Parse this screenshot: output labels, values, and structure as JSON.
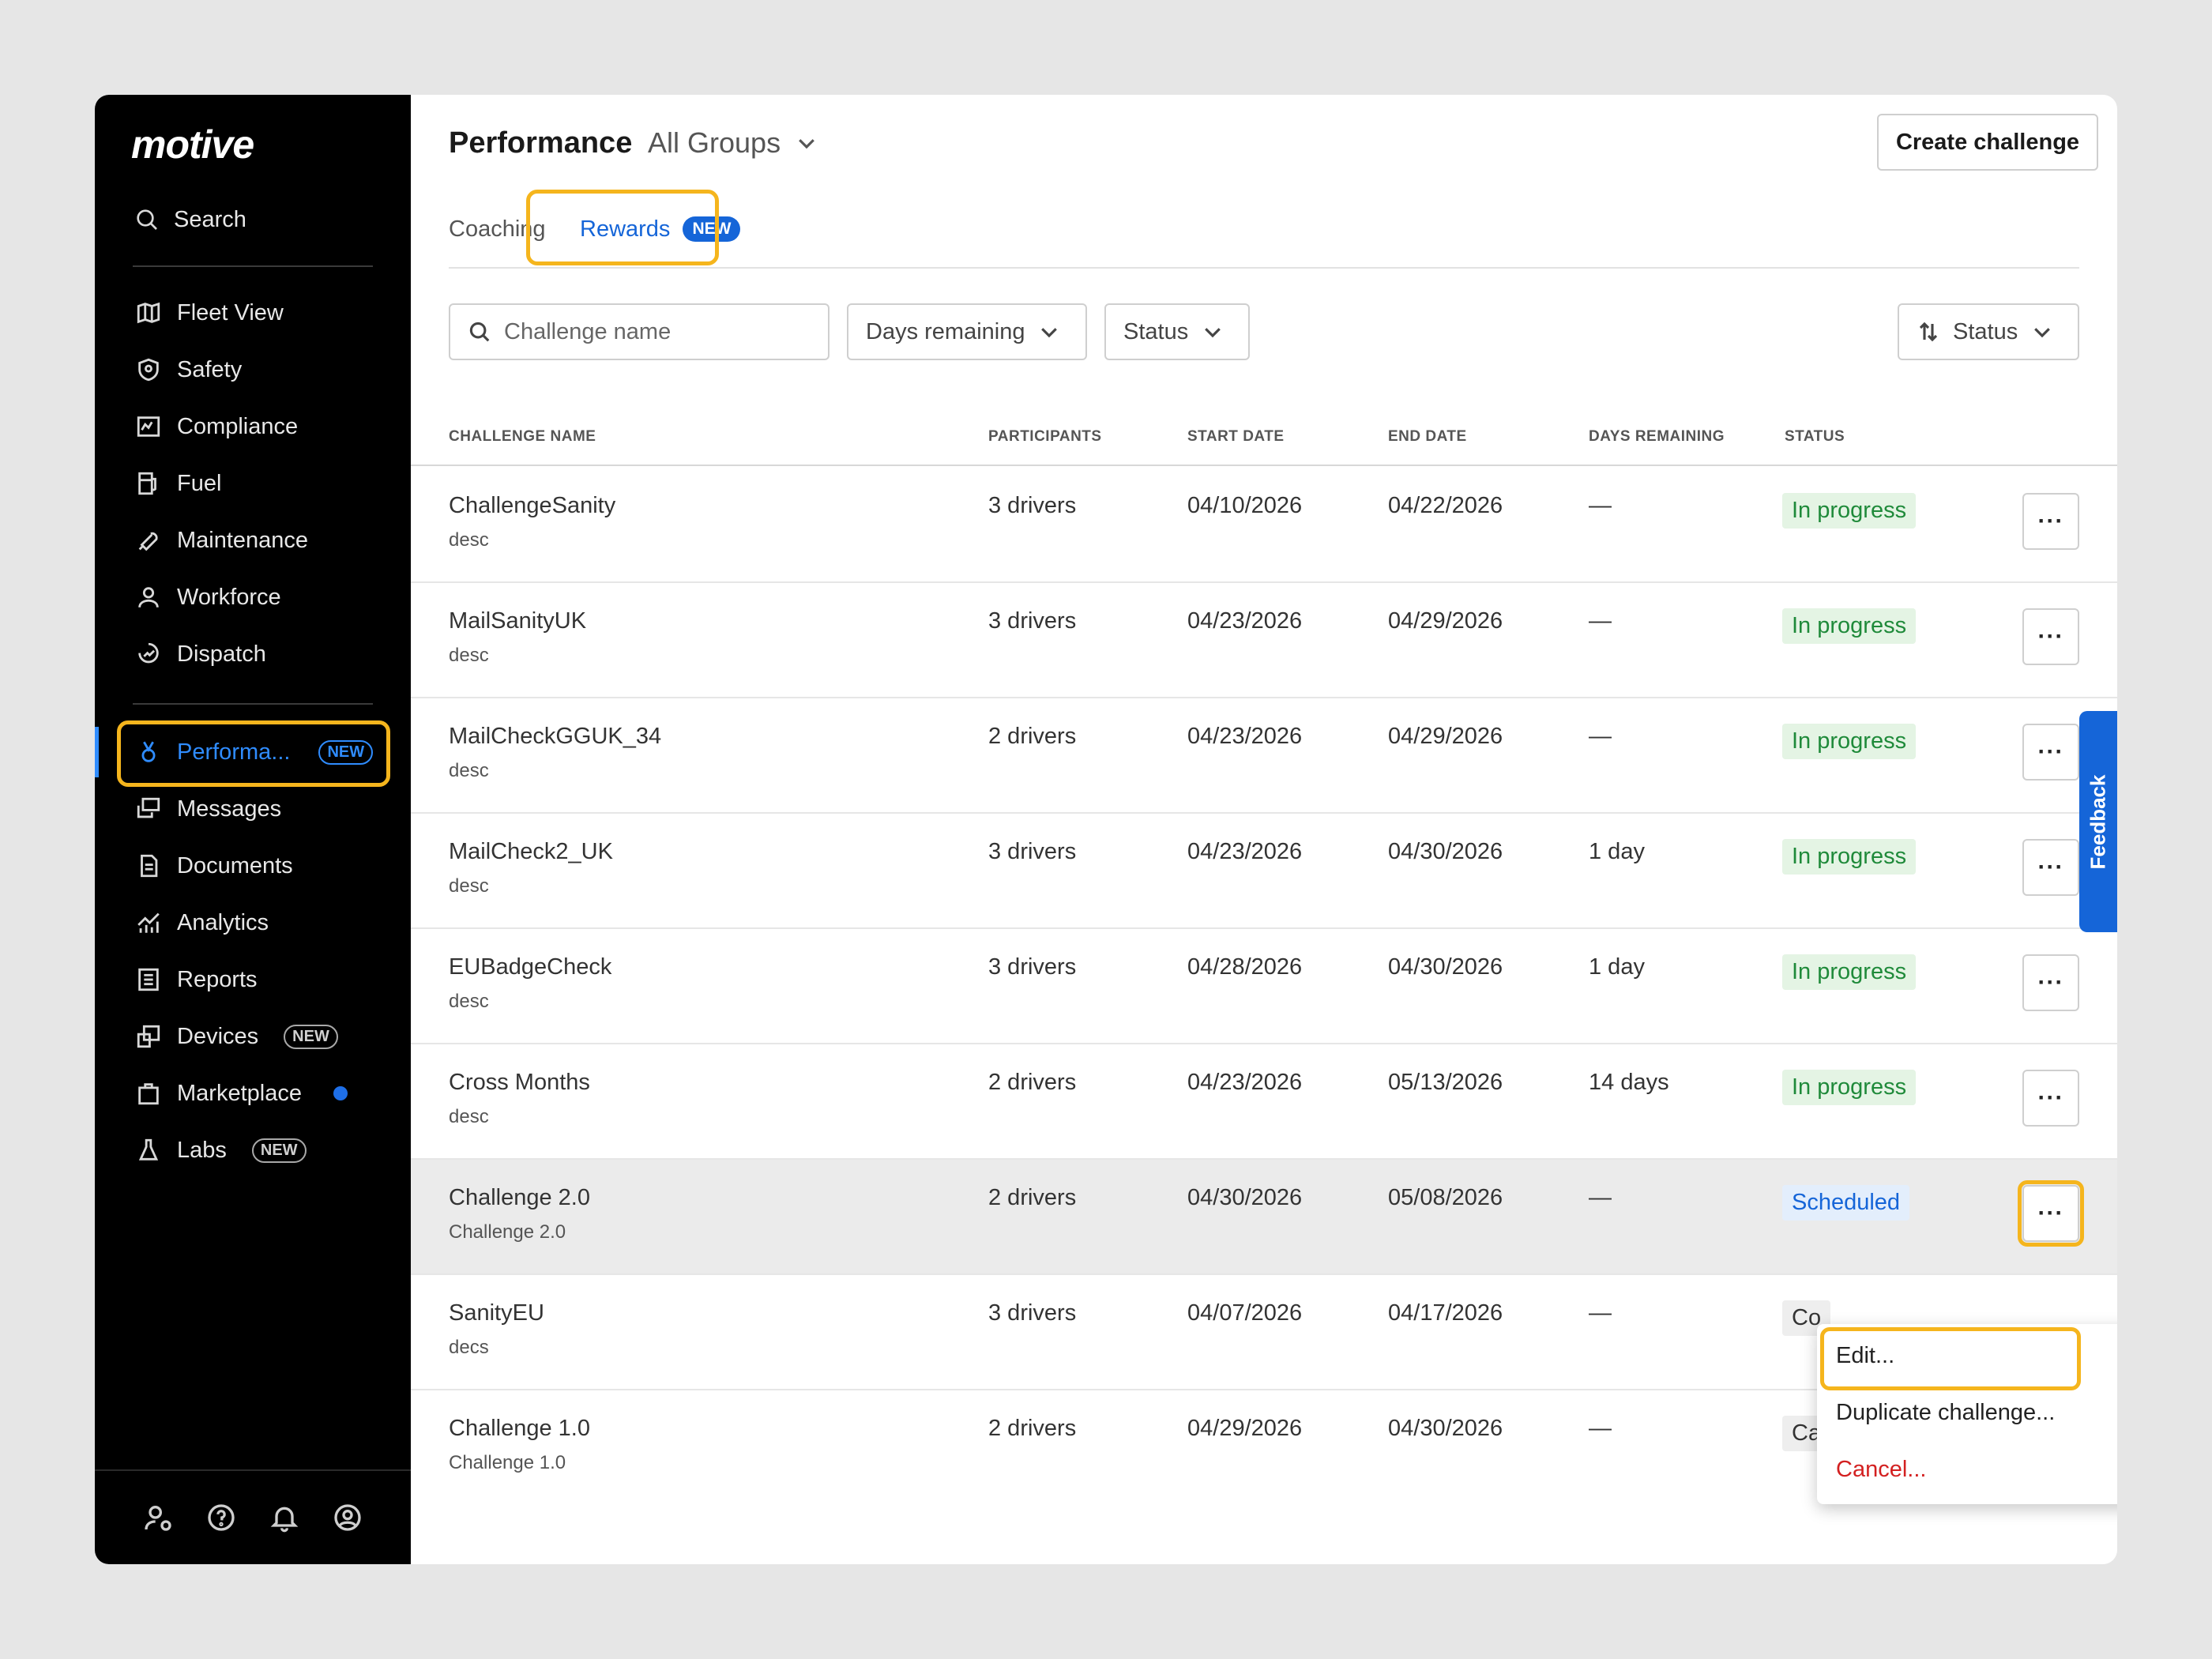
{
  "sidebar": {
    "logo": "motive",
    "search_label": "Search",
    "items_top": [
      {
        "label": "Fleet View",
        "icon": "map-icon"
      },
      {
        "label": "Safety",
        "icon": "shield-icon"
      },
      {
        "label": "Compliance",
        "icon": "compliance-icon"
      },
      {
        "label": "Fuel",
        "icon": "fuel-icon"
      },
      {
        "label": "Maintenance",
        "icon": "wrench-icon"
      },
      {
        "label": "Workforce",
        "icon": "person-icon"
      },
      {
        "label": "Dispatch",
        "icon": "dispatch-icon"
      }
    ],
    "items_bottom": [
      {
        "label": "Performa...",
        "icon": "medal-icon",
        "badge": "NEW",
        "active": true
      },
      {
        "label": "Messages",
        "icon": "messages-icon"
      },
      {
        "label": "Documents",
        "icon": "document-icon"
      },
      {
        "label": "Analytics",
        "icon": "analytics-icon"
      },
      {
        "label": "Reports",
        "icon": "reports-icon"
      },
      {
        "label": "Devices",
        "icon": "devices-icon",
        "badge": "NEW"
      },
      {
        "label": "Marketplace",
        "icon": "bag-icon",
        "dot": true
      },
      {
        "label": "Labs",
        "icon": "flask-icon",
        "badge": "NEW"
      }
    ]
  },
  "header": {
    "title": "Performance",
    "group": "All Groups",
    "create_button": "Create challenge"
  },
  "tabs": {
    "coaching": "Coaching",
    "rewards": "Rewards",
    "rewards_badge": "NEW"
  },
  "filters": {
    "search_placeholder": "Challenge name",
    "days_remaining": "Days remaining",
    "status": "Status",
    "sort": "Status"
  },
  "table": {
    "columns": [
      "CHALLENGE NAME",
      "PARTICIPANTS",
      "START DATE",
      "END DATE",
      "DAYS REMAINING",
      "STATUS"
    ],
    "rows": [
      {
        "name": "ChallengeSanity",
        "desc": "desc",
        "participants": "3 drivers",
        "start": "04/10/2026",
        "end": "04/22/2026",
        "days": "—",
        "status": "In progress",
        "kind": "progress"
      },
      {
        "name": "MailSanityUK",
        "desc": "desc",
        "participants": "3 drivers",
        "start": "04/23/2026",
        "end": "04/29/2026",
        "days": "—",
        "status": "In progress",
        "kind": "progress"
      },
      {
        "name": "MailCheckGGUK_34",
        "desc": "desc",
        "participants": "2 drivers",
        "start": "04/23/2026",
        "end": "04/29/2026",
        "days": "—",
        "status": "In progress",
        "kind": "progress"
      },
      {
        "name": "MailCheck2_UK",
        "desc": "desc",
        "participants": "3 drivers",
        "start": "04/23/2026",
        "end": "04/30/2026",
        "days": "1 day",
        "status": "In progress",
        "kind": "progress"
      },
      {
        "name": "EUBadgeCheck",
        "desc": "desc",
        "participants": "3 drivers",
        "start": "04/28/2026",
        "end": "04/30/2026",
        "days": "1 day",
        "status": "In progress",
        "kind": "progress"
      },
      {
        "name": "Cross Months",
        "desc": "desc",
        "participants": "2 drivers",
        "start": "04/23/2026",
        "end": "05/13/2026",
        "days": "14 days",
        "status": "In progress",
        "kind": "progress"
      },
      {
        "name": "Challenge 2.0",
        "desc": "Challenge 2.0",
        "participants": "2 drivers",
        "start": "04/30/2026",
        "end": "05/08/2026",
        "days": "—",
        "status": "Scheduled",
        "kind": "scheduled"
      },
      {
        "name": "SanityEU",
        "desc": "decs",
        "participants": "3 drivers",
        "start": "04/07/2026",
        "end": "04/17/2026",
        "days": "—",
        "status": "Co",
        "kind": "other"
      },
      {
        "name": "Challenge 1.0",
        "desc": "Challenge 1.0",
        "participants": "2 drivers",
        "start": "04/29/2026",
        "end": "04/30/2026",
        "days": "—",
        "status": "Cancelled",
        "kind": "other"
      }
    ],
    "more_label": "···"
  },
  "menu": {
    "edit": "Edit...",
    "duplicate": "Duplicate challenge...",
    "cancel": "Cancel..."
  },
  "feedback": "Feedback",
  "colors": {
    "accent": "#1565d8",
    "highlight": "#f5b51d",
    "success": "#1f8a3a",
    "danger": "#d32020"
  }
}
